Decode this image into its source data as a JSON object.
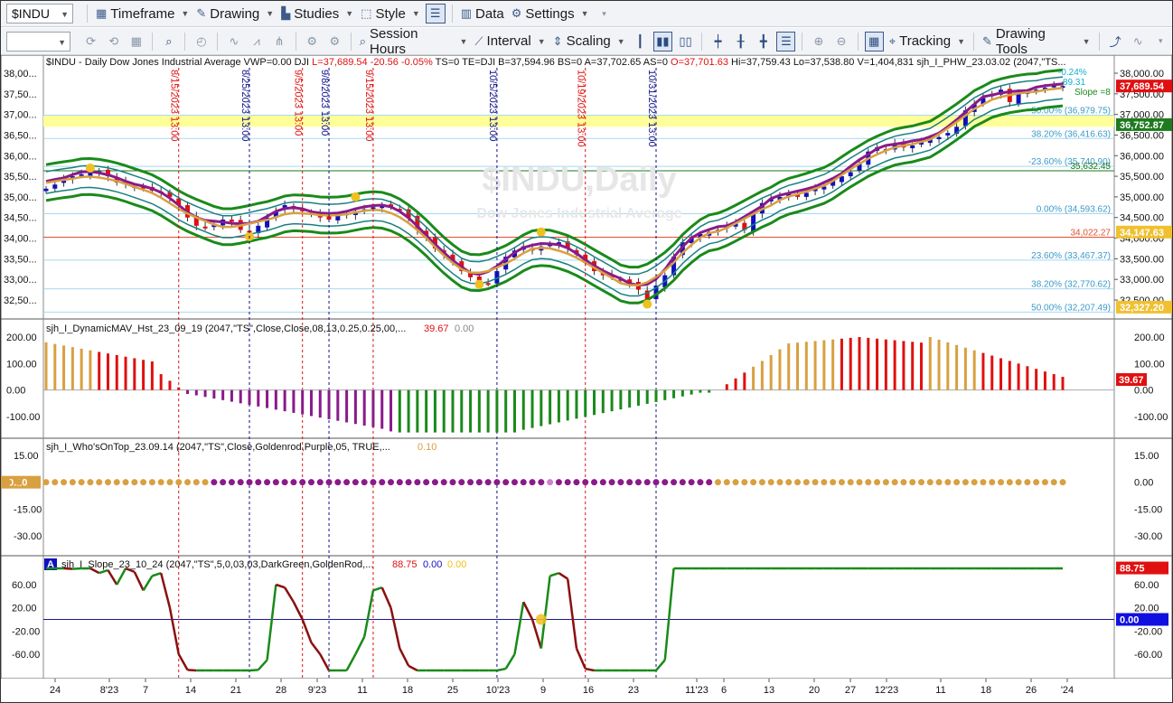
{
  "toolbar1": {
    "symbol": "$INDU",
    "timeframe": "Timeframe",
    "drawing": "Drawing",
    "studies": "Studies",
    "style": "Style",
    "data": "Data",
    "settings": "Settings"
  },
  "toolbar2": {
    "session_hours": "Session Hours",
    "interval": "Interval",
    "scaling": "Scaling",
    "tracking": "Tracking",
    "drawing_tools": "Drawing Tools"
  },
  "price_header": "$INDU - Daily  Dow Jones Industrial Average   VWP=0.00  DJI",
  "price_header_red": "L=37,689.54  -20.56  -0.05%",
  "price_header_2": "TS=0  TE=DJI  B=37,594.96  BS=0  A=37,702.65  AS=0",
  "price_header_red2": "O=37,701.63",
  "price_header_3": "Hi=37,759.43  Lo=37,538.80  V=1,404,831  sjh_I_PHW_23.03.02 (2047,\"TS...",
  "watermark": "$INDU,Daily",
  "watermark_sub": "Dow Jones Industrial Average",
  "price_axis": [
    "38,000.00",
    "37,500.00",
    "37,000.00",
    "36,500.00",
    "36,000.00",
    "35,500.00",
    "35,000.00",
    "34,500.00",
    "34,000.00",
    "33,500.00",
    "33,000.00",
    "32,500.00"
  ],
  "left_axis": [
    "38,00...",
    "37,50...",
    "37,00...",
    "36,50...",
    "36,00...",
    "35,50...",
    "35,00...",
    "34,50...",
    "34,00...",
    "33,50...",
    "33,00...",
    "32,50..."
  ],
  "price_badges": [
    {
      "text": "37,689.54",
      "color": "#e01010",
      "value": 37689.54
    },
    {
      "text": "36,752.87",
      "color": "#1e7a1e",
      "value": 36752.87
    },
    {
      "text": "34,147.63",
      "color": "#f0c030",
      "value": 34147.63
    },
    {
      "text": "32,327.20",
      "color": "#f0c030",
      "value": 32327.2
    }
  ],
  "fib_labels": [
    {
      "text": "50.00% (36,979.75)",
      "value": 36979.75
    },
    {
      "text": "38.20% (36,416.63)",
      "value": 36416.63
    },
    {
      "text": "-23.60% (35,740.90)",
      "value": 35740.9
    },
    {
      "text": "0.00% (34,593.62)",
      "value": 34593.62
    },
    {
      "text": "23.60% (33,467.37)",
      "value": 33467.37
    },
    {
      "text": "38.20% (32,770.62)",
      "value": 32770.62
    },
    {
      "text": "50.00% (32,207.49)",
      "value": 32207.49
    }
  ],
  "line_labels": [
    {
      "text": "35,632.45",
      "value": 35632.45,
      "color": "#1e7a1e"
    },
    {
      "text": "34,022.27",
      "value": 34022.27,
      "color": "#e05030"
    }
  ],
  "top_right_labels": {
    "pct": "-0.24%",
    "val": "89.31",
    "slope": "Slope =8"
  },
  "vlines": [
    {
      "label": "8/15/2023 13:00",
      "color": "#e01010",
      "date_index": 15
    },
    {
      "label": "8/25/2023 13:00",
      "color": "#10108a",
      "date_index": 23
    },
    {
      "label": "9/5/2023 13:00",
      "color": "#e01010",
      "date_index": 29
    },
    {
      "label": "9/8/2023 13:00",
      "color": "#10108a",
      "date_index": 32
    },
    {
      "label": "9/15/2023 13:00",
      "color": "#e01010",
      "date_index": 37
    },
    {
      "label": "10/5/2023 13:00",
      "color": "#10108a",
      "date_index": 51
    },
    {
      "label": "10/19/2023 13:00",
      "color": "#e01010",
      "date_index": 61
    },
    {
      "label": "10/31/2023 13:00",
      "color": "#10108a",
      "date_index": 69
    }
  ],
  "x_axis": [
    "24",
    "8'23",
    "7",
    "14",
    "21",
    "28",
    "9'23",
    "11",
    "18",
    "25",
    "10'23",
    "9",
    "16",
    "23",
    "11'23",
    "6",
    "13",
    "20",
    "27",
    "12'23",
    "11",
    "18",
    "26",
    "'24"
  ],
  "panel2": {
    "title": "sjh_I_DynamicMAV_Hst_23_09_19 (2047,\"TS\",Close,Close,08,13,0.25,0.25,00,...",
    "v1": "39.67",
    "v2": "0.00",
    "axis": [
      "200.00",
      "100.00",
      "0.00",
      "-100.00"
    ],
    "badge": "39.67"
  },
  "panel3": {
    "title": "sjh_I_Who'sOnTop_23.09.14 (2047,\"TS\",Close,Goldenrod,Purple,05,  TRUE,...",
    "v1": "0.10",
    "axis": [
      "15.00",
      "0.00",
      "-15.00",
      "-30.00"
    ],
    "left_badge": "0.10"
  },
  "panel4": {
    "marker": "A",
    "title": "sjh_I_Slope_23_10_24 (2047,\"TS\",5,0,03,03,DarkGreen,GoldenRod,...",
    "v1": "88.75",
    "v2": "0.00",
    "v3": "0.00",
    "axis": [
      "60.00",
      "20.00",
      "-20.00",
      "-60.00"
    ],
    "left_axis": [
      "60.00",
      "20.00",
      "-20.00",
      "-60.00"
    ],
    "badge_red": "88.75",
    "badge_blue": "0.00"
  },
  "colors": {
    "up": "#1010c0",
    "down": "#e01010",
    "ma_purple": "#8a1a8a",
    "ma_gold": "#d8a040",
    "band_green": "#1a8a1a",
    "band_teal": "#1a8080",
    "highlight": "#ffff99"
  },
  "chart_data": {
    "type": "candlestick",
    "title": "$INDU - Daily",
    "closes": [
      35200,
      35300,
      35450,
      35500,
      35550,
      35600,
      35620,
      35500,
      35350,
      35300,
      35250,
      35200,
      35150,
      35100,
      35000,
      34800,
      34500,
      34300,
      34250,
      34350,
      34450,
      34400,
      34200,
      34100,
      34300,
      34500,
      34650,
      34800,
      34700,
      34650,
      34600,
      34500,
      34450,
      34550,
      34600,
      34650,
      34700,
      34750,
      34800,
      34750,
      34700,
      34500,
      34200,
      34000,
      33750,
      33600,
      33400,
      33200,
      33050,
      32950,
      32900,
      33200,
      33550,
      33700,
      33800,
      33700,
      33800,
      33850,
      33900,
      33750,
      33600,
      33400,
      33200,
      33100,
      33050,
      33000,
      32900,
      32750,
      32500,
      32850,
      33100,
      33550,
      33900,
      34000,
      34100,
      34150,
      34200,
      34300,
      34350,
      34200,
      34600,
      34850,
      34950,
      35000,
      35100,
      35000,
      35100,
      35200,
      35250,
      35400,
      35500,
      35600,
      35800,
      36100,
      36200,
      36150,
      36300,
      36200,
      36250,
      36350,
      36400,
      36450,
      36550,
      36700,
      37100,
      37250,
      37400,
      37500,
      37600,
      37300,
      37500,
      37550,
      37600,
      37650,
      37700,
      37689
    ]
  }
}
